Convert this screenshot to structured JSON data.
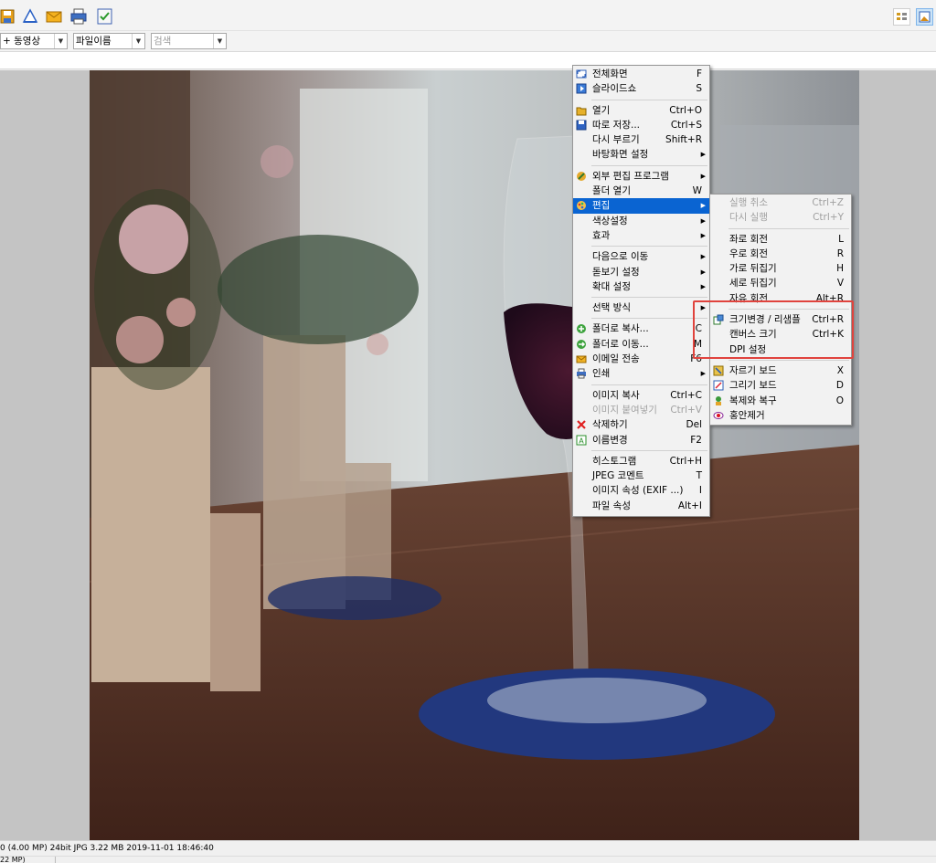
{
  "toolbar": {
    "left_icons": [
      "save-icon",
      "triangle-tool-icon",
      "email-icon",
      "print-icon",
      "checklist-icon"
    ],
    "right_icons": [
      "grid-view-icon",
      "image-view-icon"
    ]
  },
  "filter": {
    "type_value": "+ 동영상",
    "sort_value": "파일이름",
    "search_placeholder": "검색"
  },
  "status": {
    "line1": "0 (4.00 MP)  24bit  JPG   3.22 MB   2019-11-01 18:46:40",
    "line2": "  22 MP)"
  },
  "context_menu": [
    {
      "label": "전체화면",
      "shortcut": "F",
      "icon": "fullscreen-icon"
    },
    {
      "label": "슬라이드쇼",
      "shortcut": "S",
      "icon": "slideshow-icon"
    },
    {
      "sep": true
    },
    {
      "label": "열기",
      "shortcut": "Ctrl+O",
      "icon": "open-icon"
    },
    {
      "label": "따로 저장...",
      "shortcut": "Ctrl+S",
      "icon": "save-icon"
    },
    {
      "label": "다시 부르기",
      "shortcut": "Shift+R"
    },
    {
      "label": "바탕화면 설정",
      "submenu": true
    },
    {
      "sep": true
    },
    {
      "label": "외부 편집 프로그램",
      "submenu": true,
      "icon": "external-editor-icon"
    },
    {
      "label": "폴더 열기",
      "shortcut": "W"
    },
    {
      "label": "편집",
      "submenu": true,
      "highlighted": true,
      "icon": "edit-icon"
    },
    {
      "label": "색상설정",
      "submenu": true
    },
    {
      "label": "효과",
      "submenu": true
    },
    {
      "sep": true
    },
    {
      "label": "다음으로 이동",
      "submenu": true
    },
    {
      "label": "돋보기 설정",
      "submenu": true
    },
    {
      "label": "확대 설정",
      "submenu": true
    },
    {
      "sep": true
    },
    {
      "label": "선택 방식",
      "submenu": true
    },
    {
      "sep": true
    },
    {
      "label": "폴더로 복사...",
      "shortcut": "C",
      "icon": "copy-to-folder-icon"
    },
    {
      "label": "폴더로 이동...",
      "shortcut": "M",
      "icon": "move-to-folder-icon"
    },
    {
      "label": "이메일 전송",
      "shortcut": "F6",
      "icon": "email-icon"
    },
    {
      "label": "인쇄",
      "submenu": true,
      "icon": "print-icon"
    },
    {
      "sep": true
    },
    {
      "label": "이미지 복사",
      "shortcut": "Ctrl+C"
    },
    {
      "label": "이미지 붙여넣기",
      "shortcut": "Ctrl+V",
      "disabled": true
    },
    {
      "label": "삭제하기",
      "shortcut": "Del",
      "icon": "delete-icon"
    },
    {
      "label": "이름변경",
      "shortcut": "F2",
      "icon": "rename-icon"
    },
    {
      "sep": true
    },
    {
      "label": "히스토그램",
      "shortcut": "Ctrl+H"
    },
    {
      "label": "JPEG 코멘트",
      "shortcut": "T"
    },
    {
      "label": "이미지 속성 (EXIF ...)",
      "shortcut": "I"
    },
    {
      "label": "파일 속성",
      "shortcut": "Alt+I"
    }
  ],
  "edit_submenu": [
    {
      "label": "실행 취소",
      "shortcut": "Ctrl+Z",
      "disabled": true
    },
    {
      "label": "다시 실행",
      "shortcut": "Ctrl+Y",
      "disabled": true
    },
    {
      "sep": true
    },
    {
      "label": "좌로 회전",
      "shortcut": "L"
    },
    {
      "label": "우로 회전",
      "shortcut": "R"
    },
    {
      "label": "가로 뒤집기",
      "shortcut": "H"
    },
    {
      "label": "세로 뒤집기",
      "shortcut": "V"
    },
    {
      "label": "자유 회전",
      "shortcut": "Alt+R"
    },
    {
      "sep": true
    },
    {
      "label": "크기변경 / 리샘플",
      "shortcut": "Ctrl+R",
      "icon": "resize-icon"
    },
    {
      "label": "캔버스 크기",
      "shortcut": "Ctrl+K"
    },
    {
      "label": "DPI 설정",
      "shortcut": ""
    },
    {
      "sep": true
    },
    {
      "label": "자르기 보드",
      "shortcut": "X",
      "icon": "crop-icon"
    },
    {
      "label": "그리기 보드",
      "shortcut": "D",
      "icon": "draw-icon"
    },
    {
      "label": "복제와 복구",
      "shortcut": "O",
      "icon": "clone-icon"
    },
    {
      "label": "홍안제거",
      "shortcut": "",
      "icon": "red-eye-icon"
    }
  ],
  "colors": {
    "highlight": "#0a64d2",
    "annotation_box": "#e0433d"
  }
}
